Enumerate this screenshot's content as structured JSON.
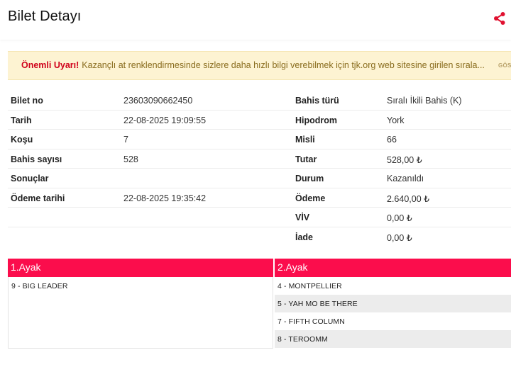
{
  "header": {
    "title": "Bilet Detayı",
    "share_icon": "share-icon"
  },
  "warning": {
    "strong": "Önemli Uyarı!",
    "text": "Kazançlı at renklendirmesinde sizlere daha hızlı bilgi verebilmek için tjk.org web sitesine girilen sırala...",
    "button": "GÖS"
  },
  "details": [
    {
      "l1": "Bilet no",
      "v1": "23603090662450",
      "l2": "Bahis türü",
      "v2": "Sıralı İkili Bahis (K)"
    },
    {
      "l1": "Tarih",
      "v1": "22-08-2025 19:09:55",
      "l2": "Hipodrom",
      "v2": "York"
    },
    {
      "l1": "Koşu",
      "v1": "7",
      "l2": "Misli",
      "v2": "66"
    },
    {
      "l1": "Bahis sayısı",
      "v1": "528",
      "l2": "Tutar",
      "v2": "528,00 ₺"
    },
    {
      "l1": "Sonuçlar",
      "v1": "",
      "l2": "Durum",
      "v2": "Kazanıldı"
    },
    {
      "l1": "Ödeme tarihi",
      "v1": "22-08-2025 19:35:42",
      "l2": "Ödeme",
      "v2": "2.640,00 ₺"
    },
    {
      "l1": "",
      "v1": "",
      "l2": "VİV",
      "v2": "0,00 ₺"
    },
    {
      "l1": "",
      "v1": "",
      "l2": "İade",
      "v2": "0,00 ₺"
    }
  ],
  "legs": [
    {
      "title": "1.Ayak",
      "runners": [
        "9 - BIG LEADER"
      ]
    },
    {
      "title": "2.Ayak",
      "runners": [
        "4 - MONTPELLIER",
        "5 - YAH MO BE THERE",
        "7 - FIFTH COLUMN",
        "8 - TEROOMM"
      ]
    }
  ],
  "colors": {
    "accent": "#fb0d4c",
    "warning_bg": "#fdf3d2",
    "warning_strong": "#d0021b"
  }
}
